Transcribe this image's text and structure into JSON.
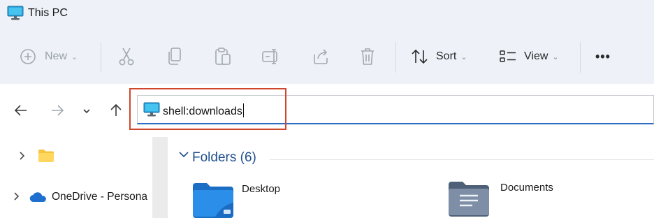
{
  "window": {
    "title": "This PC",
    "title_icon": "monitor-icon"
  },
  "toolbar": {
    "new_label": "New",
    "sort_label": "Sort",
    "view_label": "View",
    "more_label": "•••",
    "icons": [
      "plus-circle-icon",
      "cut-icon",
      "copy-icon",
      "paste-icon",
      "rename-icon",
      "share-icon",
      "delete-icon",
      "sort-icon",
      "view-icon",
      "more-icon"
    ]
  },
  "navigation": {
    "icons": [
      "back-arrow-icon",
      "forward-arrow-icon",
      "recent-locations-icon",
      "up-arrow-icon"
    ]
  },
  "address_bar": {
    "value": "shell:downloads",
    "icon": "monitor-icon"
  },
  "sidebar": {
    "items": [
      {
        "label": "",
        "icon": "folder-icon"
      },
      {
        "label": "OneDrive - Persona",
        "icon": "cloud-icon"
      }
    ]
  },
  "content": {
    "group_title": "Folders (6)",
    "folders": [
      {
        "name": "Desktop",
        "icon": "desktop-folder-icon"
      },
      {
        "name": "Documents",
        "icon": "documents-folder-icon"
      }
    ]
  },
  "colors": {
    "accent": "#2b6cc4",
    "highlight_box": "#d0462a",
    "chrome_background": "#eef2f8",
    "group_title": "#1f4f8f"
  }
}
